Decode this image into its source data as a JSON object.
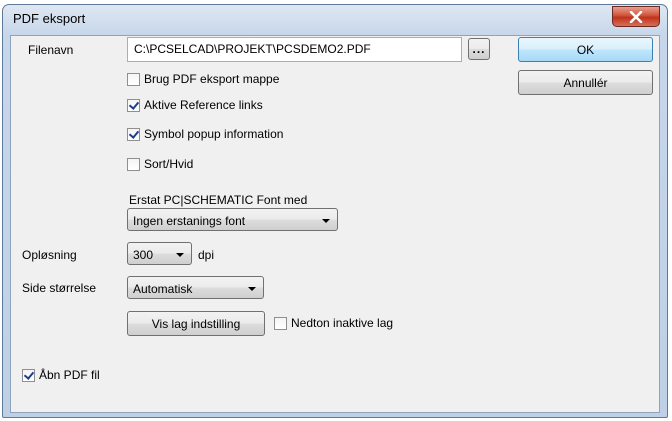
{
  "window": {
    "title": "PDF eksport"
  },
  "filename": {
    "label": "Filenavn",
    "value": "C:\\PCSELCAD\\PROJEKT\\PCSDEMO2.PDF",
    "browse_label": "..."
  },
  "buttons": {
    "ok": "OK",
    "cancel": "Annullér"
  },
  "options": {
    "brug_pdf_mappe": {
      "label": "Brug PDF eksport mappe",
      "checked": false
    },
    "aktive_ref_links": {
      "label": "Aktive Reference links",
      "checked": true
    },
    "symbol_popup": {
      "label": "Symbol popup information",
      "checked": true
    },
    "sort_hvid": {
      "label": "Sort/Hvid",
      "checked": false
    }
  },
  "font_replace": {
    "label": "Erstat PC|SCHEMATIC Font med",
    "selected": "Ingen erstanings font"
  },
  "resolution": {
    "label": "Opløsning",
    "selected": "300",
    "unit": "dpi"
  },
  "page_size": {
    "label": "Side størrelse",
    "selected": "Automatisk"
  },
  "layers": {
    "button_label": "Vis lag indstilling",
    "dim_inactive": {
      "label": "Nedton inaktive lag",
      "checked": false
    }
  },
  "open_pdf": {
    "label": "Åbn PDF fil",
    "checked": true
  }
}
